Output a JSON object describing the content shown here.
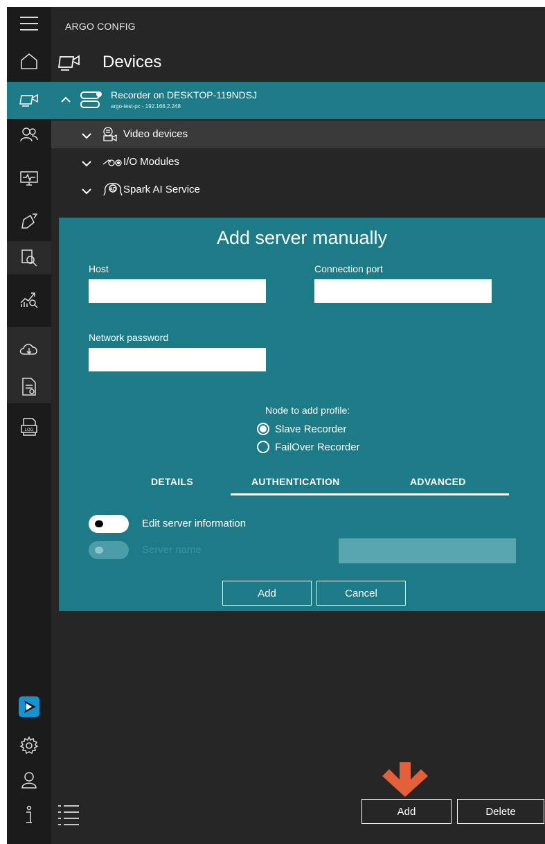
{
  "app": {
    "title": "ARGO CONFIG",
    "page_title": "Devices",
    "accent_color": "#1d7a87"
  },
  "sidebar": {
    "items": [
      {
        "icon": "menu-icon"
      },
      {
        "icon": "home-icon"
      },
      {
        "icon": "devices-icon",
        "active": true
      },
      {
        "icon": "users-icon"
      },
      {
        "icon": "monitor-icon"
      },
      {
        "icon": "alarm-icon"
      },
      {
        "icon": "search-document-icon"
      },
      {
        "icon": "analytics-icon"
      },
      {
        "icon": "cloud-icon"
      },
      {
        "icon": "report-icon"
      },
      {
        "icon": "log-icon"
      },
      {
        "icon": "play-logo-icon"
      },
      {
        "icon": "gear-icon"
      },
      {
        "icon": "user-icon"
      },
      {
        "icon": "info-icon"
      }
    ]
  },
  "tree": {
    "server_name": "Recorder on DESKTOP-119NDSJ",
    "server_sub": "argo-test-pc - 192.168.2.248",
    "children": [
      {
        "label": "Video devices",
        "icon": "video-devices-icon"
      },
      {
        "label": "I/O Modules",
        "icon": "io-modules-icon"
      },
      {
        "label": "Spark AI Service",
        "icon": "ai-service-icon"
      }
    ]
  },
  "dialog": {
    "title": "Add server manually",
    "host_label": "Host",
    "host_value": "",
    "port_label": "Connection port",
    "port_value": "",
    "password_label": "Network password",
    "password_value": "",
    "node_label": "Node to add profile:",
    "radio_slave": "Slave Recorder",
    "radio_failover": "FailOver Recorder",
    "tabs": [
      "DETAILS",
      "AUTHENTICATION",
      "ADVANCED"
    ],
    "active_tab": "AUTHENTICATION",
    "edit_info_label": "Edit server information",
    "server_name_label": "Server name",
    "add_label": "Add",
    "cancel_label": "Cancel"
  },
  "bottom": {
    "add_label": "Add",
    "delete_label": "Delete",
    "arrow_color": "#e2603a"
  }
}
